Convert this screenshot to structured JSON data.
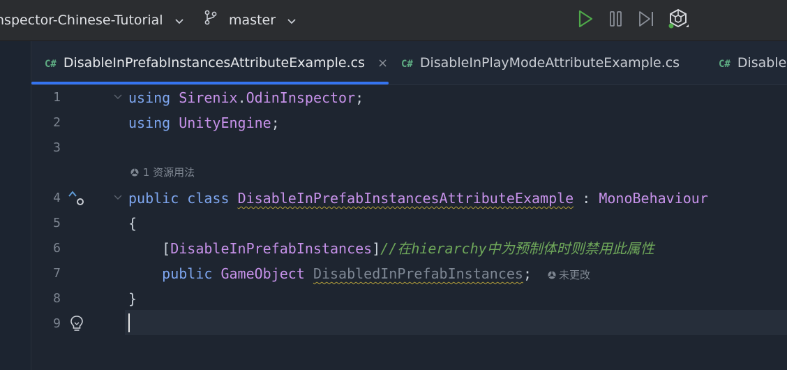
{
  "titlebar": {
    "project_name": "nspector-Chinese-Tutorial",
    "branch_name": "master",
    "run_icon": "run-triangle-icon",
    "pause_icon": "pause-icon",
    "step_icon": "step-forward-icon",
    "unity_icon": "unity-logo-icon"
  },
  "tabs": [
    {
      "badge": "C#",
      "label": "DisableInPrefabInstancesAttributeExample.cs",
      "close": "×"
    },
    {
      "badge": "C#",
      "label": "DisableInPlayModeAttributeExample.cs"
    },
    {
      "badge": "C#",
      "label": "Disable"
    }
  ],
  "editor": {
    "line_numbers": [
      "1",
      "2",
      "3",
      "4",
      "5",
      "6",
      "7",
      "8",
      "9"
    ],
    "line1": {
      "kw": "using",
      "ns1": "Sirenix",
      "dot": ".",
      "ns2": "OdinInspector",
      "semi": ";"
    },
    "line2": {
      "kw": "using",
      "ns": "UnityEngine",
      "semi": ";"
    },
    "usage_hint": "1 资源用法",
    "line4": {
      "kw1": "public",
      "kw2": "class",
      "class_name": "DisableInPrefabInstancesAttributeExample",
      "colon": ":",
      "base": "MonoBehaviour"
    },
    "line5": "{",
    "line6": {
      "open": "[",
      "attr": "DisableInPrefabInstances",
      "close": "]",
      "comment_start": "//在",
      "comment_word": "hierarchy",
      "comment_end": "中为预制体时则禁用此属性"
    },
    "line7": {
      "kw": "public",
      "type": "GameObject",
      "field": "DisabledInPrefabInstances",
      "semi": ";",
      "hint": "未更改"
    },
    "line8": "}"
  },
  "colors": {
    "accent": "#3574f0",
    "keyword": "#7ea6ef",
    "type": "#c792ea",
    "comment": "#6fa85a",
    "run_green": "#4fa84a"
  }
}
